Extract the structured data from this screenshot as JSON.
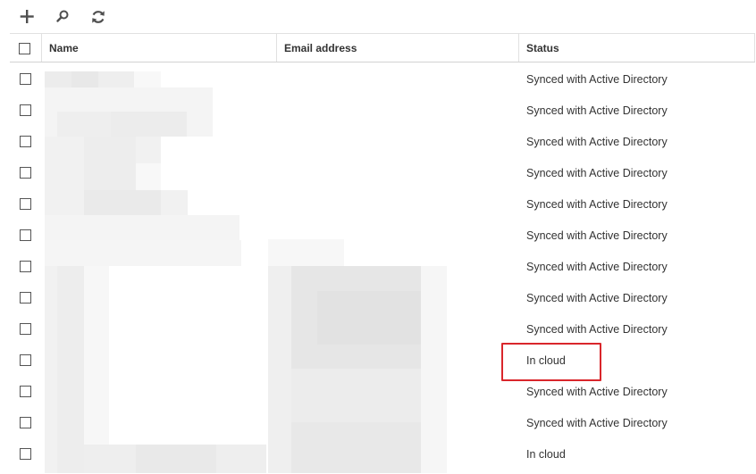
{
  "toolbar": {
    "items": [
      {
        "icon": "plus-icon"
      },
      {
        "icon": "search-icon"
      },
      {
        "icon": "refresh-icon"
      }
    ]
  },
  "table": {
    "columns": {
      "name": "Name",
      "email": "Email address",
      "status": "Status"
    },
    "rows": [
      {
        "status": "Synced with Active Directory"
      },
      {
        "status": "Synced with Active Directory"
      },
      {
        "status": "Synced with Active Directory"
      },
      {
        "status": "Synced with Active Directory"
      },
      {
        "status": "Synced with Active Directory"
      },
      {
        "status": "Synced with Active Directory"
      },
      {
        "status": "Synced with Active Directory"
      },
      {
        "status": "Synced with Active Directory"
      },
      {
        "status": "Synced with Active Directory"
      },
      {
        "status": "In cloud"
      },
      {
        "status": "Synced with Active Directory"
      },
      {
        "status": "Synced with Active Directory"
      },
      {
        "status": "In cloud"
      }
    ]
  },
  "colors": {
    "highlight": "#d9262b",
    "icon": "#505050"
  }
}
